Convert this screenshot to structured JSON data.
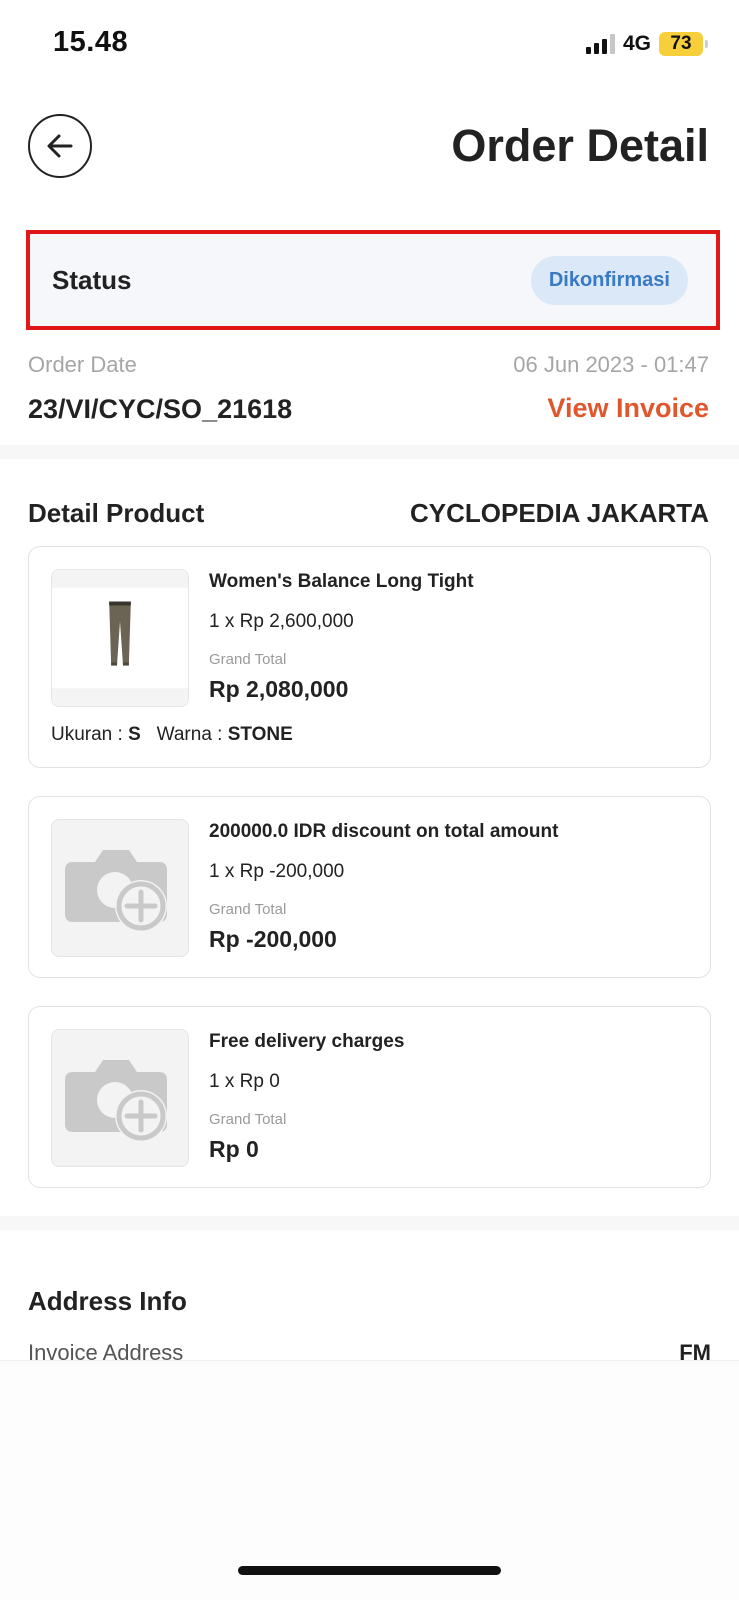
{
  "status_bar": {
    "time": "15.48",
    "network": "4G",
    "battery": "73"
  },
  "header": {
    "title": "Order Detail"
  },
  "status": {
    "label": "Status",
    "badge": "Dikonfirmasi"
  },
  "order": {
    "date_label": "Order Date",
    "date_value": "06 Jun 2023 - 01:47",
    "number": "23/VI/CYC/SO_21618",
    "invoice_link": "View Invoice"
  },
  "detail": {
    "title": "Detail Product",
    "store": "CYCLOPEDIA JAKARTA"
  },
  "items": [
    {
      "name": "Women's Balance Long Tight",
      "qty": "1 x Rp 2,600,000",
      "grand_total_label": "Grand Total",
      "grand_total": "Rp 2,080,000",
      "size_label": "Ukuran : ",
      "size": "S",
      "color_label": "Warna : ",
      "color": "STONE"
    },
    {
      "name": "200000.0 IDR discount on total amount",
      "qty": "1 x Rp -200,000",
      "grand_total_label": "Grand Total",
      "grand_total": "Rp -200,000"
    },
    {
      "name": "Free delivery charges",
      "qty": "1 x Rp 0",
      "grand_total_label": "Grand Total",
      "grand_total": "Rp 0"
    }
  ],
  "address": {
    "title": "Address Info",
    "invoice_address_label": "Invoice Address",
    "invoice_address_value": "FM"
  },
  "colors": {
    "accent": "#e0572e",
    "status_badge_text": "#3a7ac4",
    "status_badge_bg": "#dbe8f7",
    "highlight_border": "#e01818"
  }
}
